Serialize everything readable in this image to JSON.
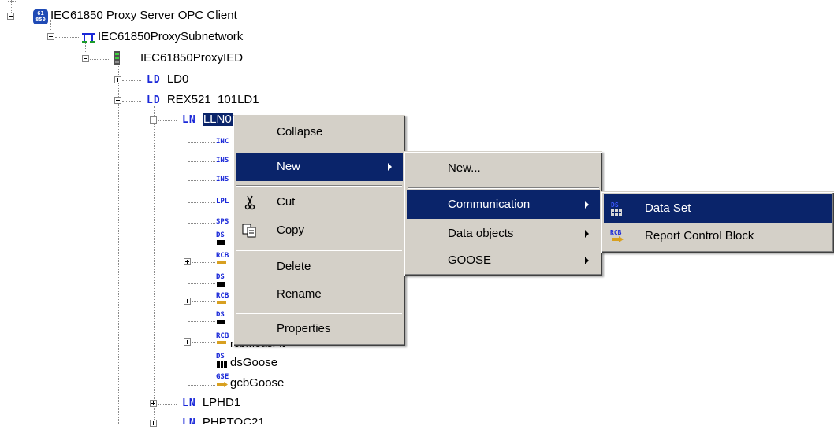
{
  "tree": {
    "root": {
      "label": "IEC61850 Proxy Server OPC Client",
      "icon_text": "61\n850"
    },
    "subnetwork": {
      "label": "IEC61850ProxySubnetwork"
    },
    "ied": {
      "label": "IEC61850ProxyIED"
    },
    "ld_tag": "LD",
    "ln_tag": "LN",
    "ld0": {
      "label": "LD0"
    },
    "ld1": {
      "label": "REX521_101LD1"
    },
    "lln0": {
      "label": "LLN0"
    },
    "children": [
      {
        "tag": "INC"
      },
      {
        "tag": "INS"
      },
      {
        "tag": "INS"
      },
      {
        "tag": "LPL"
      },
      {
        "tag": "SPS"
      }
    ],
    "ds_tag": "DS",
    "rcb_tag": "RCB",
    "gse_tag": "GSE",
    "partial_rcb_label": "rcbMeasFlt",
    "ds_goose": {
      "label": "dsGoose"
    },
    "gcb_goose": {
      "label": "gcbGoose"
    },
    "lphd1": {
      "label": "LPHD1"
    },
    "next_ln_partial": "PHPTOC21"
  },
  "context_menu": {
    "items": [
      {
        "label": "Collapse"
      },
      {
        "label": "New",
        "highlighted": true
      },
      {
        "label": "Cut",
        "icon": "scissors-icon"
      },
      {
        "label": "Copy",
        "icon": "copy-icon"
      },
      {
        "label": "Delete"
      },
      {
        "label": "Rename"
      },
      {
        "label": "Properties"
      }
    ]
  },
  "submenu_new": {
    "items": [
      {
        "label": "New..."
      },
      {
        "label": "Communication",
        "highlighted": true
      },
      {
        "label": "Data objects"
      },
      {
        "label": "GOOSE"
      }
    ]
  },
  "submenu_communication": {
    "items": [
      {
        "label": "Data Set",
        "icon": "data-set-icon",
        "highlighted": true
      },
      {
        "label": "Report Control Block",
        "icon": "rcb-icon"
      }
    ]
  },
  "colors": {
    "highlight": "#0a246a",
    "menu_bg": "#d4d0c8",
    "tag_blue": "#1a28d8"
  }
}
